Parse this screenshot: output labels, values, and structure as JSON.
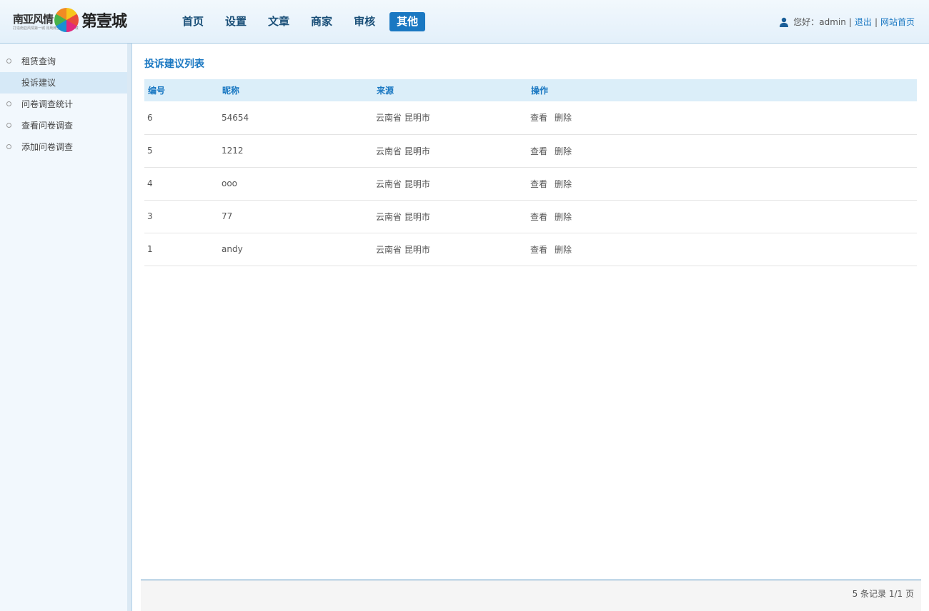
{
  "logo": {
    "left_text": "南亚风情",
    "sub_text": "打造南亚风情第一城 昆明南亚风情第一城",
    "right_text": "第壹城"
  },
  "nav": [
    "首页",
    "设置",
    "文章",
    "商家",
    "审核",
    "其他"
  ],
  "nav_active_index": 5,
  "user": {
    "greeting": "您好：admin",
    "sep": "|",
    "logout": "退出",
    "home": "网站首页"
  },
  "sidebar": {
    "items": [
      "租赁查询",
      "投诉建议",
      "问卷调查统计",
      "查看问卷调查",
      "添加问卷调查"
    ],
    "active_index": 1
  },
  "page_title": "投诉建议列表",
  "table": {
    "headers": [
      "编号",
      "昵称",
      "来源",
      "操作"
    ],
    "view_label": "查看",
    "delete_label": "删除",
    "rows": [
      {
        "id": "6",
        "nickname": "54654",
        "source": "云南省 昆明市"
      },
      {
        "id": "5",
        "nickname": "1212",
        "source": "云南省 昆明市"
      },
      {
        "id": "4",
        "nickname": "ooo",
        "source": "云南省 昆明市"
      },
      {
        "id": "3",
        "nickname": "77",
        "source": "云南省 昆明市"
      },
      {
        "id": "1",
        "nickname": "andy",
        "source": "云南省 昆明市"
      }
    ]
  },
  "pager": "5 条记录 1/1 页",
  "colors": {
    "accent": "#1a78c2",
    "header_bg": "#e3f0fa",
    "th_bg": "#dbeef9"
  }
}
